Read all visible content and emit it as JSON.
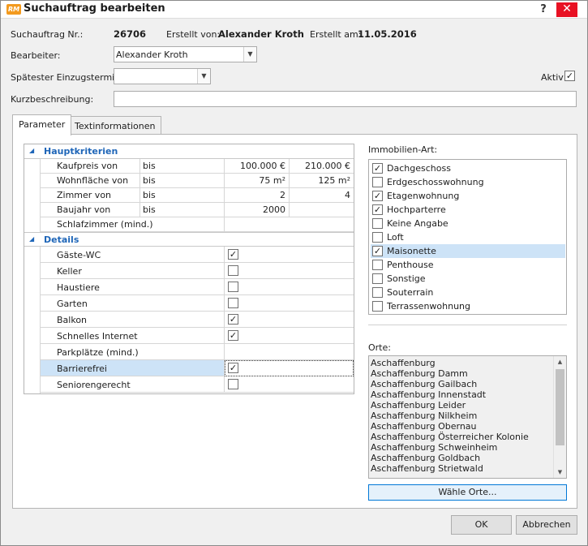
{
  "window": {
    "app_icon_text": "RM",
    "title": "Suchauftrag bearbeiten",
    "help_glyph": "?",
    "close_glyph": "✕"
  },
  "header": {
    "nr_label": "Suchauftrag Nr.:",
    "nr_value": "26706",
    "created_by_label": "Erstellt von:",
    "created_by_value": "Alexander Kroth",
    "created_on_label": "Erstellt am:",
    "created_on_value": "11.05.2016",
    "bearbeiter_label": "Bearbeiter:",
    "bearbeiter_value": "Alexander Kroth",
    "einzug_label": "Spätester Einzugstermin:",
    "einzug_value": "",
    "aktiv_label": "Aktiv",
    "aktiv_checked": true,
    "kurz_label": "Kurzbeschreibung:",
    "kurz_value": ""
  },
  "tabs": [
    {
      "label": "Parameter",
      "active": true
    },
    {
      "label": "Textinformationen",
      "active": false
    }
  ],
  "grid": {
    "section_main": "Hauptkriterien",
    "main_rows": [
      {
        "name": "Kaufpreis von",
        "op": "bis",
        "from": "100.000 €",
        "to": "210.000 €"
      },
      {
        "name": "Wohnfläche von",
        "op": "bis",
        "from": "75 m²",
        "to": "125 m²"
      },
      {
        "name": "Zimmer von",
        "op": "bis",
        "from": "2",
        "to": "4"
      },
      {
        "name": "Baujahr von",
        "op": "bis",
        "from": "2000",
        "to": ""
      },
      {
        "name": "Schlafzimmer (mind.)",
        "op": "",
        "from": "",
        "to": ""
      }
    ],
    "section_details": "Details",
    "detail_rows": [
      {
        "name": "Gäste-WC",
        "checked": true,
        "has_checkbox": true
      },
      {
        "name": "Keller",
        "checked": false,
        "has_checkbox": true
      },
      {
        "name": "Haustiere",
        "checked": false,
        "has_checkbox": true
      },
      {
        "name": "Garten",
        "checked": false,
        "has_checkbox": true
      },
      {
        "name": "Balkon",
        "checked": true,
        "has_checkbox": true
      },
      {
        "name": "Schnelles Internet",
        "checked": true,
        "has_checkbox": true
      },
      {
        "name": "Parkplätze (mind.)",
        "checked": false,
        "has_checkbox": false
      },
      {
        "name": "Barrierefrei",
        "checked": true,
        "has_checkbox": true,
        "selected": true
      },
      {
        "name": "Seniorengerecht",
        "checked": false,
        "has_checkbox": true
      }
    ]
  },
  "immobilien": {
    "label": "Immobilien-Art:",
    "items": [
      {
        "label": "Dachgeschoss",
        "checked": true
      },
      {
        "label": "Erdgeschosswohnung",
        "checked": false
      },
      {
        "label": "Etagenwohnung",
        "checked": true
      },
      {
        "label": "Hochparterre",
        "checked": true
      },
      {
        "label": "Keine Angabe",
        "checked": false
      },
      {
        "label": "Loft",
        "checked": false
      },
      {
        "label": "Maisonette",
        "checked": true,
        "selected": true
      },
      {
        "label": "Penthouse",
        "checked": false
      },
      {
        "label": "Sonstige",
        "checked": false
      },
      {
        "label": "Souterrain",
        "checked": false
      },
      {
        "label": "Terrassenwohnung",
        "checked": false
      }
    ]
  },
  "orte": {
    "label": "Orte:",
    "items": [
      "Aschaffenburg",
      "Aschaffenburg Damm",
      "Aschaffenburg Gailbach",
      "Aschaffenburg Innenstadt",
      "Aschaffenburg Leider",
      "Aschaffenburg Nilkheim",
      "Aschaffenburg Obernau",
      "Aschaffenburg Österreicher Kolonie",
      "Aschaffenburg Schweinheim",
      "Aschaffenburg Goldbach",
      "Aschaffenburg Strietwald"
    ],
    "choose_button": "Wähle Orte..."
  },
  "footer": {
    "ok": "OK",
    "cancel": "Abbrechen"
  },
  "glyphs": {
    "check": "✓",
    "combo_arrow": "▼",
    "section_open": "◢",
    "scroll_up": "▲",
    "scroll_down": "▼"
  },
  "colors": {
    "accent_blue": "#1f66b8",
    "selection": "#cde3f7",
    "close_red": "#e81123"
  }
}
